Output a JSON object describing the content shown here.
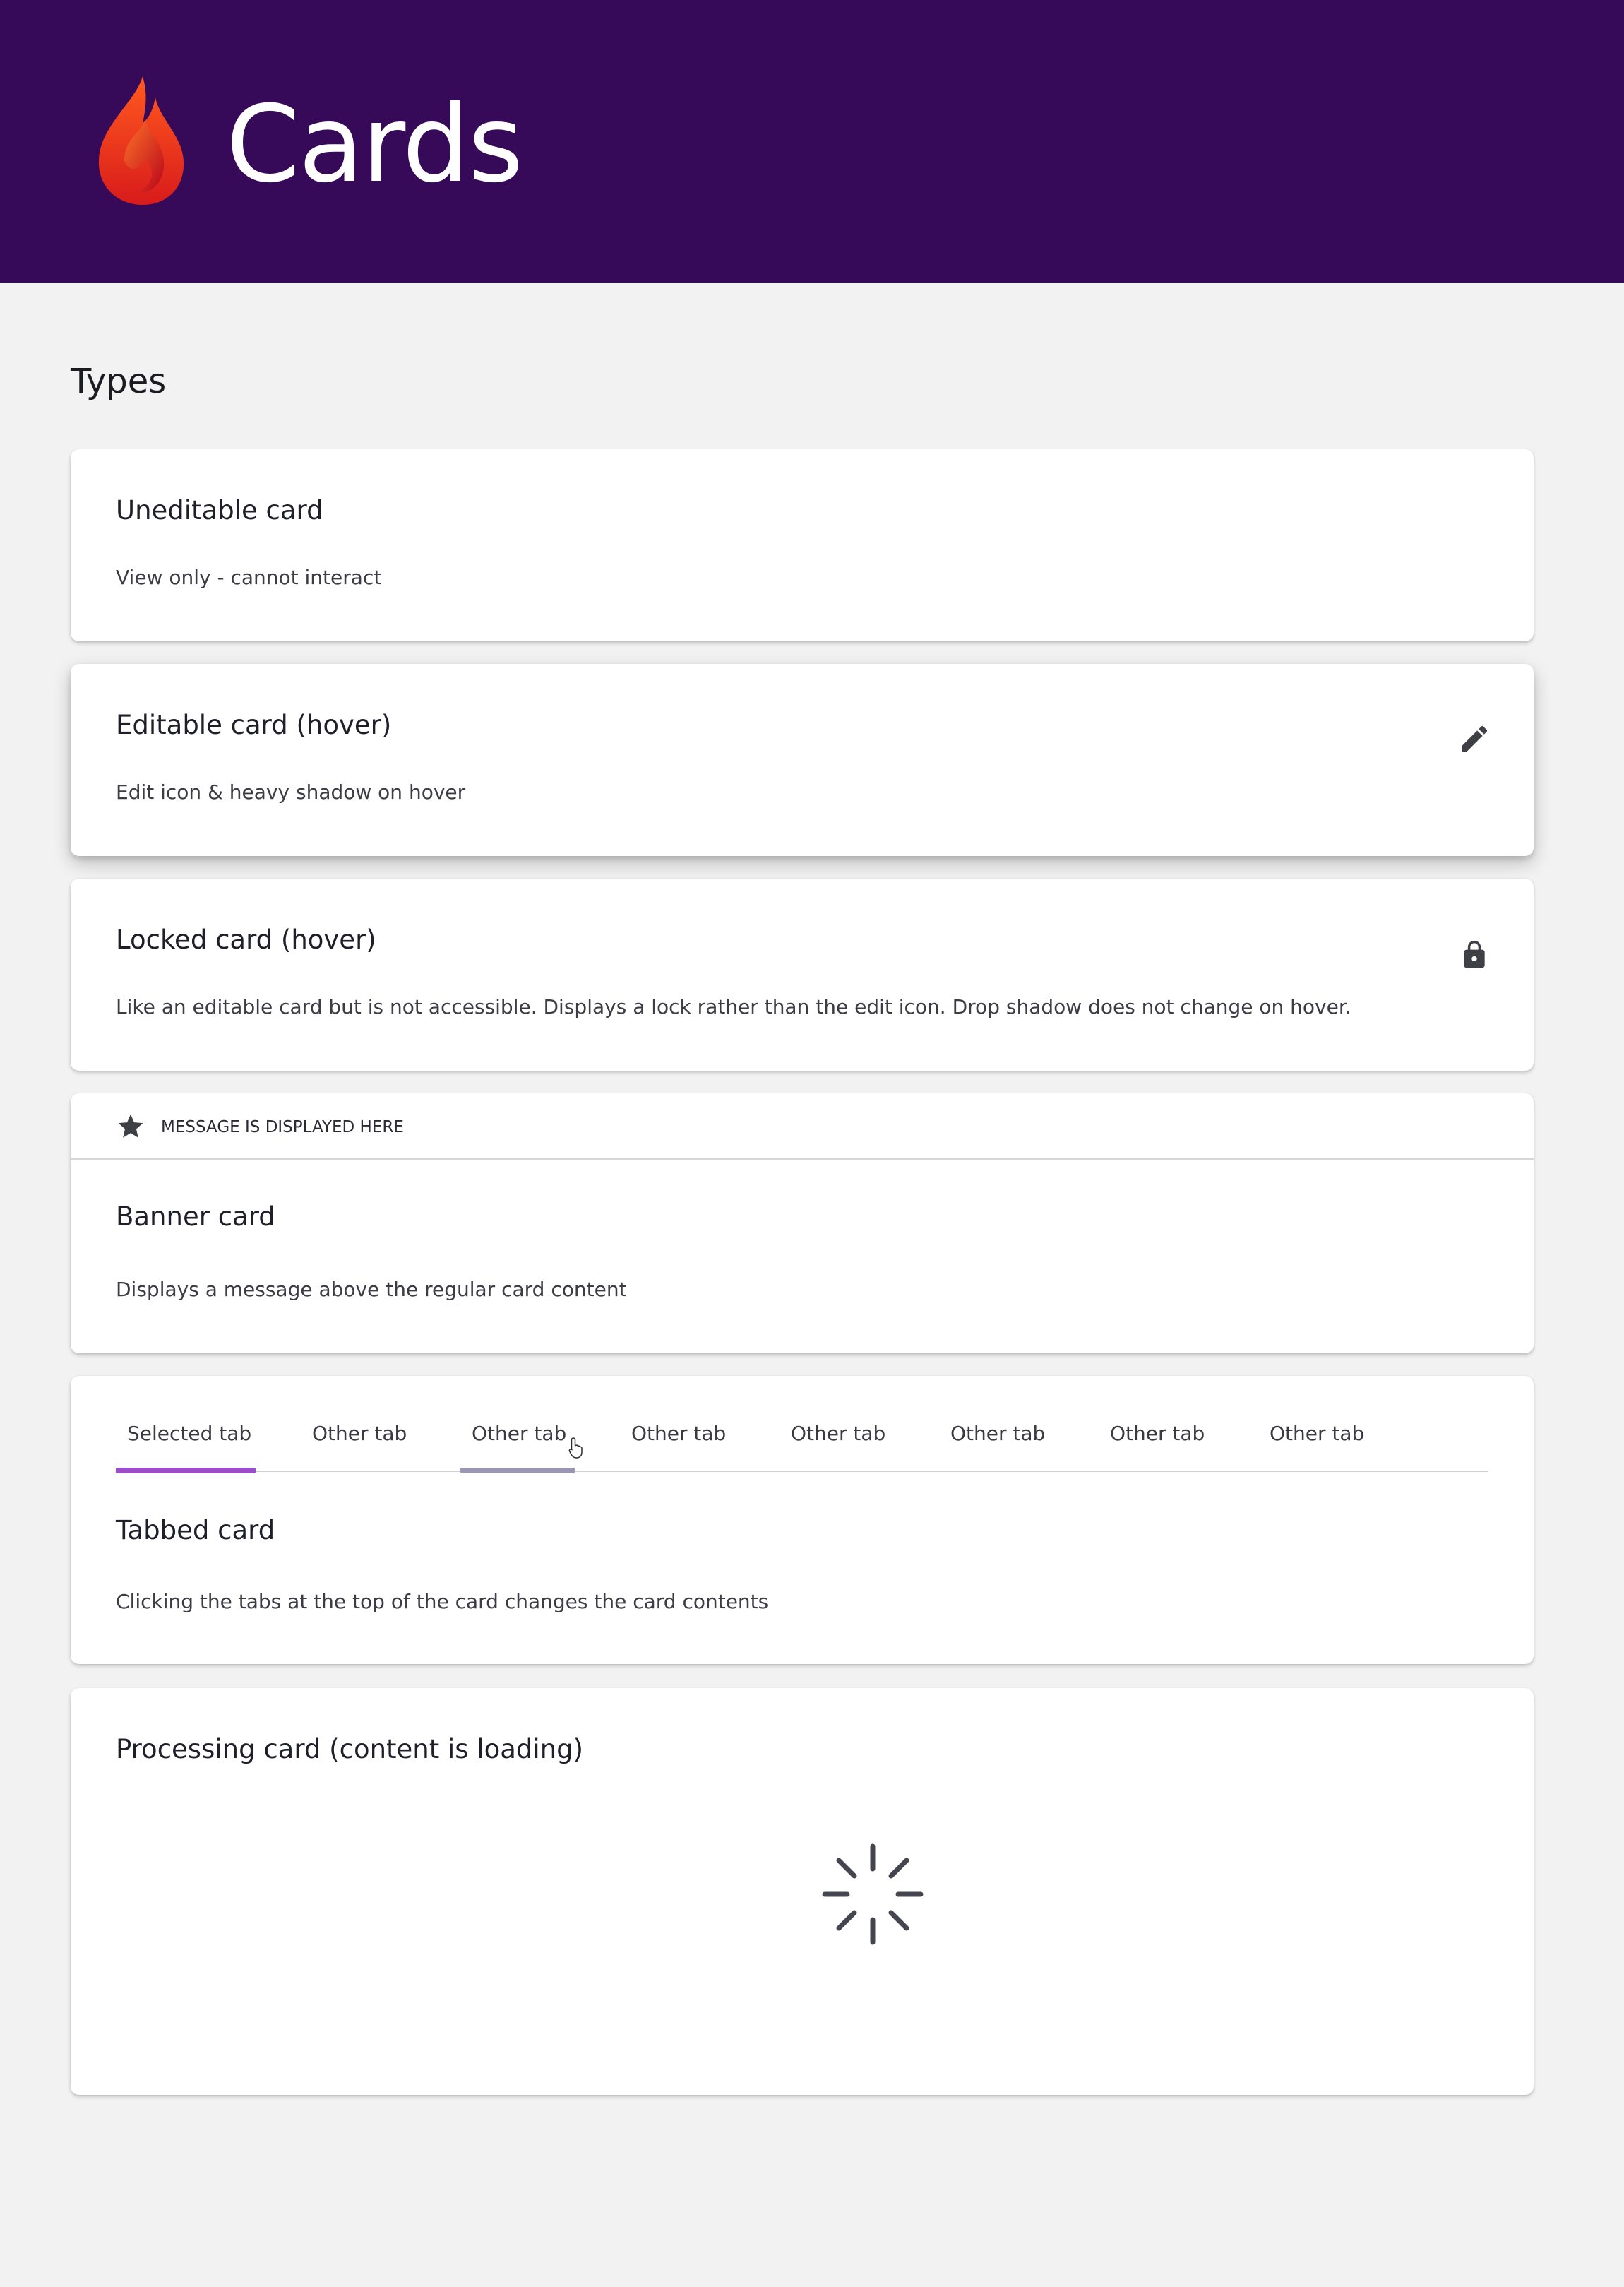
{
  "header": {
    "title": "Cards",
    "logo_icon": "flame-logo",
    "background": "#360a58",
    "logo_colors": [
      "#ff3d1f",
      "#c8102e"
    ]
  },
  "section": {
    "title": "Types"
  },
  "cards": {
    "uneditable": {
      "title": "Uneditable card",
      "description": "View only - cannot interact"
    },
    "editable": {
      "title": "Editable card (hover)",
      "description": "Edit icon & heavy shadow on hover",
      "icon": "pencil-icon"
    },
    "locked": {
      "title": "Locked card (hover)",
      "description": "Like an editable card but is not accessible. Displays a lock rather than the edit icon. Drop shadow does not change on hover.",
      "icon": "lock-icon"
    },
    "banner": {
      "message": "Message is displayed here",
      "banner_icon": "star-icon",
      "title": "Banner card",
      "description": "Displays a message above the regular card content"
    },
    "tabbed": {
      "tabs": [
        {
          "label": "Selected tab",
          "state": "selected"
        },
        {
          "label": "Other tab",
          "state": "normal"
        },
        {
          "label": "Other tab",
          "state": "hover"
        },
        {
          "label": "Other tab",
          "state": "normal"
        },
        {
          "label": "Other tab",
          "state": "normal"
        },
        {
          "label": "Other tab",
          "state": "normal"
        },
        {
          "label": "Other tab",
          "state": "normal"
        },
        {
          "label": "Other tab",
          "state": "normal"
        }
      ],
      "selected_color": "#9b4dca",
      "hover_color": "#9a95b0",
      "title": "Tabbed card",
      "description": "Clicking the tabs at the top of the card changes the card contents"
    },
    "processing": {
      "title": "Processing card (content is loading)",
      "loader_icon": "spinner-icon"
    }
  }
}
